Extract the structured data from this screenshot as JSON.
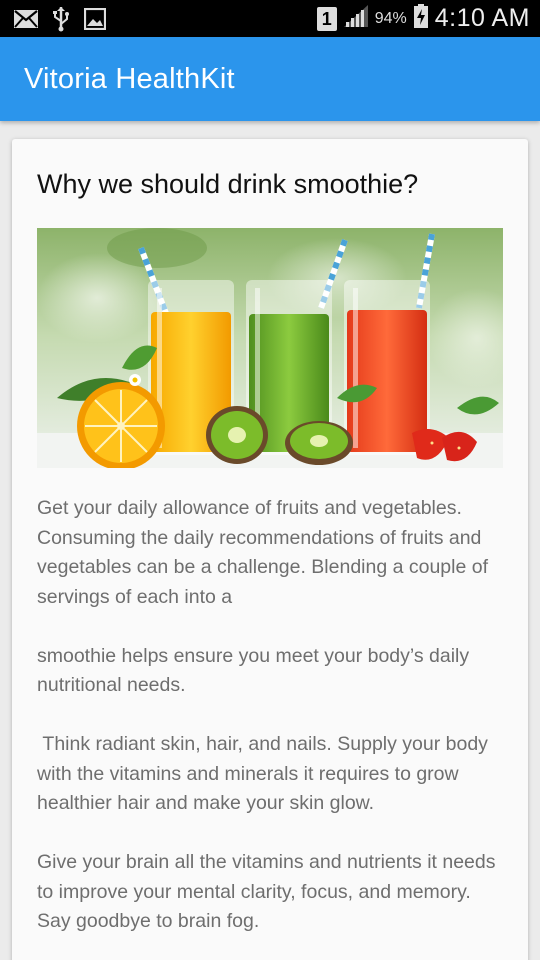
{
  "status_bar": {
    "left_icons": [
      "mail-icon",
      "usb-icon",
      "image-icon"
    ],
    "sim_label": "1",
    "battery_percent": "94%",
    "time": "4:10 AM"
  },
  "app_bar": {
    "title": "Vitoria HealthKit"
  },
  "article": {
    "title": "Why we should drink smoothie?",
    "image_icon": "smoothie-glasses-image",
    "paragraphs": [
      "Get your daily allowance of fruits and vegetables. Consuming the daily recommendations of fruits and vegetables can be a challenge. Blending a couple of servings of each into a",
      "smoothie helps ensure you meet your body’s daily nutritional needs.",
      " Think radiant skin, hair, and nails. Supply your body with the vitamins and minerals it requires to grow healthier hair and make your skin glow.",
      "Give your brain all the vitamins and nutrients it needs to improve your mental clarity, focus, and memory. Say goodbye to brain fog."
    ]
  }
}
